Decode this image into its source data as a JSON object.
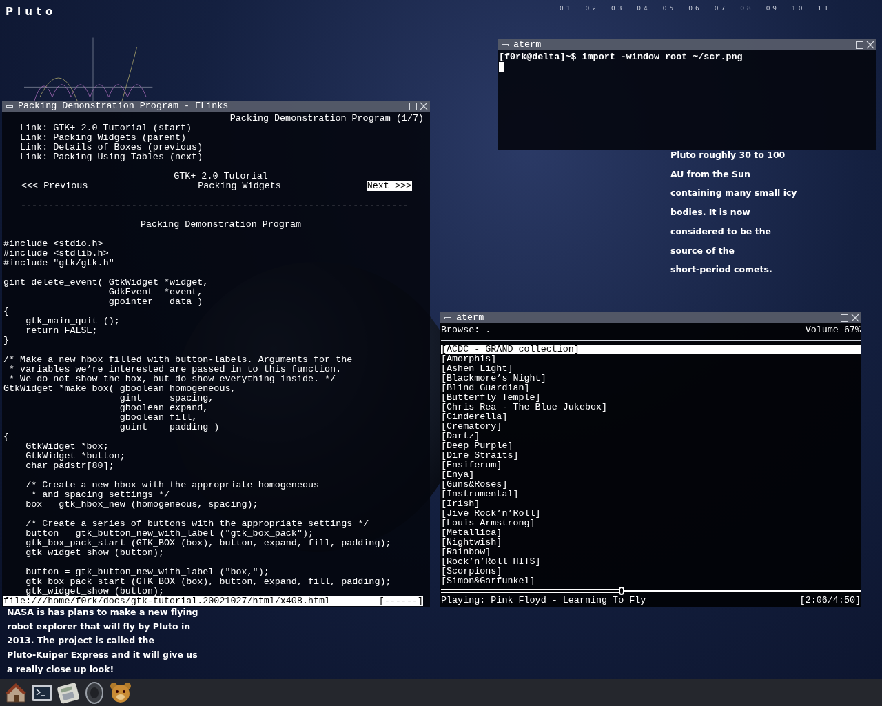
{
  "desktop": {
    "title": "Pluto",
    "clock_marks": [
      "01",
      "02",
      "03",
      "04",
      "05",
      "06",
      "07",
      "08",
      "09",
      "10",
      "11"
    ]
  },
  "kuiper_text": [
    "Pluto roughly 30 to 100",
    "AU from the Sun",
    "containing many small icy",
    "bodies. It is now",
    "considered to be the",
    "source of the",
    "short-period comets."
  ],
  "nasa_text": [
    "NASA is has plans to make a new flying",
    "robot explorer that will fly by Pluto in",
    "2013. The project is called the",
    "Pluto-Kuiper Express and it will give us",
    "a really close up look!"
  ],
  "elinks": {
    "title": "Packing Demonstration Program - ELinks",
    "header": "Packing Demonstration Program (1/7)",
    "links": [
      "Link: GTK+ 2.0 Tutorial (start)",
      "Link: Packing Widgets (parent)",
      "Link: Details of Boxes (previous)",
      "Link: Packing Using Tables (next)"
    ],
    "nav_title": "GTK+ 2.0 Tutorial",
    "prev": "<<< Previous",
    "section": "Packing Widgets",
    "next": "Next >>>",
    "rule": "----------------------------------------------------------------------",
    "heading": "Packing Demonstration Program",
    "code": [
      [
        "#include <stdio.h>",
        "#include <stdlib.h>",
        "#include \"gtk/gtk.h\""
      ],
      [
        "gint delete_event( GtkWidget *widget,",
        "                   GdkEvent  *event,",
        "                   gpointer   data )",
        "{",
        "    gtk_main_quit ();",
        "    return FALSE;",
        "}"
      ],
      [
        "/* Make a new hbox filled with button-labels. Arguments for the",
        " * variables we’re interested are passed in to this function.",
        " * We do not show the box, but do show everything inside. */",
        "GtkWidget *make_box( gboolean homogeneous,",
        "                     gint     spacing,",
        "                     gboolean expand,",
        "                     gboolean fill,",
        "                     guint    padding )",
        "{",
        "    GtkWidget *box;",
        "    GtkWidget *button;",
        "    char padstr[80];"
      ],
      [
        "    /* Create a new hbox with the appropriate homogeneous",
        "     * and spacing settings */",
        "    box = gtk_hbox_new (homogeneous, spacing);"
      ],
      [
        "    /* Create a series of buttons with the appropriate settings */",
        "    button = gtk_button_new_with_label (\"gtk_box_pack\");",
        "    gtk_box_pack_start (GTK_BOX (box), button, expand, fill, padding);",
        "    gtk_widget_show (button);"
      ],
      [
        "    button = gtk_button_new_with_label (\"box,\");",
        "    gtk_box_pack_start (GTK_BOX (box), button, expand, fill, padding);",
        "    gtk_widget_show (button);"
      ]
    ],
    "status_url": "file:///home/f0rk/docs/gtk-tutorial.20021027/html/x408.html",
    "status_progress": "[------]"
  },
  "shell": {
    "title": "aterm",
    "prompt_line": "[f0rk@delta]~$ import -window root ~/scr.png"
  },
  "player": {
    "title": "aterm",
    "browse": "Browse: .",
    "volume": "Volume 67%",
    "items": [
      {
        "label": "[ACDC - GRAND collection]",
        "selected": true
      },
      {
        "label": "[Amorphis]",
        "selected": false
      },
      {
        "label": "[Ashen Light]",
        "selected": false
      },
      {
        "label": "[Blackmore’s Night]",
        "selected": false
      },
      {
        "label": "[Blind Guardian]",
        "selected": false
      },
      {
        "label": "[Butterfly Temple]",
        "selected": false
      },
      {
        "label": "[Chris Rea - The Blue Jukebox]",
        "selected": false
      },
      {
        "label": "[Cinderella]",
        "selected": false
      },
      {
        "label": "[Crematory]",
        "selected": false
      },
      {
        "label": "[Dartz]",
        "selected": false
      },
      {
        "label": "[Deep Purple]",
        "selected": false
      },
      {
        "label": "[Dire Straits]",
        "selected": false
      },
      {
        "label": "[Ensiferum]",
        "selected": false
      },
      {
        "label": "[Enya]",
        "selected": false
      },
      {
        "label": "[Guns&Roses]",
        "selected": false
      },
      {
        "label": "[Instrumental]",
        "selected": false
      },
      {
        "label": "[Irish]",
        "selected": false
      },
      {
        "label": "[Jive Rock’n’Roll]",
        "selected": false
      },
      {
        "label": "[Louis Armstrong]",
        "selected": false
      },
      {
        "label": "[Metallica]",
        "selected": false
      },
      {
        "label": "[Nightwish]",
        "selected": false
      },
      {
        "label": "[Rainbow]",
        "selected": false
      },
      {
        "label": "[Rock’n’Roll HITS]",
        "selected": false
      },
      {
        "label": "[Scorpions]",
        "selected": false
      },
      {
        "label": "[Simon&Garfunkel]",
        "selected": false
      }
    ],
    "progress": {
      "level": 0.43
    },
    "now_playing": "Playing: Pink Floyd - Learning To Fly",
    "time": "[2:06/4:50]"
  },
  "dock": {
    "items": [
      {
        "kind": "home"
      },
      {
        "kind": "terminal"
      },
      {
        "kind": "calculator"
      },
      {
        "kind": "speaker"
      },
      {
        "kind": "bear"
      }
    ]
  }
}
